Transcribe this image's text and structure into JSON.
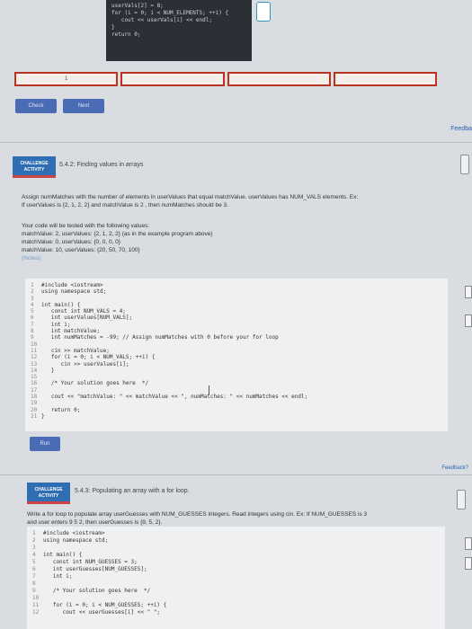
{
  "top_snippet": {
    "lines": [
      "userVals[2] = 8;",
      "",
      "for (i = 0; i < NUM_ELEMENTS; ++i) {",
      "   cout << userVals[i] << endl;",
      "}",
      "",
      "return 0;"
    ]
  },
  "progress": {
    "segments": [
      "1",
      "",
      "",
      ""
    ]
  },
  "buttons": {
    "check": "Check",
    "next": "Next",
    "run": "Run"
  },
  "feedback_top": "Feedba",
  "challenge1": {
    "badge_line1": "CHALLENGE",
    "badge_line2": "ACTIVITY",
    "title": "5.4.2: Finding values in arrays",
    "prose": [
      "Assign numMatches with the number of elements in userValues that equal matchValue. userValues has NUM_VALS elements. Ex:",
      "If userValues is {2, 1, 2, 2} and matchValue is 2 , then numMatches should be 3."
    ],
    "test_intro": "Your code will be tested with the following values:",
    "tests": [
      "matchValue: 2, userValues: {2, 1, 2, 2} (as in the example program above)",
      "matchValue: 0, userValues: {0, 0, 0, 0}",
      "matchValue: 10, userValues: {20, 50, 70, 100}"
    ],
    "notes": "(Notes)"
  },
  "editor1": {
    "lines": [
      {
        "n": "1",
        "t": "#include <iostream>"
      },
      {
        "n": "2",
        "t": "using namespace std;"
      },
      {
        "n": "3",
        "t": ""
      },
      {
        "n": "4",
        "t": "int main() {"
      },
      {
        "n": "5",
        "t": "   const int NUM_VALS = 4;"
      },
      {
        "n": "6",
        "t": "   int userValues[NUM_VALS];"
      },
      {
        "n": "7",
        "t": "   int i;"
      },
      {
        "n": "8",
        "t": "   int matchValue;"
      },
      {
        "n": "9",
        "t": "   int numMatches = -99; // Assign numMatches with 0 before your for loop"
      },
      {
        "n": "10",
        "t": ""
      },
      {
        "n": "11",
        "t": "   cin >> matchValue;"
      },
      {
        "n": "12",
        "t": "   for (i = 0; i < NUM_VALS; ++i) {"
      },
      {
        "n": "13",
        "t": "      cin >> userValues[i];"
      },
      {
        "n": "14",
        "t": "   }"
      },
      {
        "n": "15",
        "t": ""
      },
      {
        "n": "16",
        "t": "   /* Your solution goes here  */"
      },
      {
        "n": "17",
        "t": ""
      },
      {
        "n": "18",
        "t": "   cout << \"matchValue: \" << matchValue << \", numMatches: \" << numMatches << endl;"
      },
      {
        "n": "19",
        "t": ""
      },
      {
        "n": "20",
        "t": "   return 0;"
      },
      {
        "n": "21",
        "t": "}"
      }
    ]
  },
  "feedback_mid": "Feedback?",
  "challenge2": {
    "badge_line1": "CHALLENGE",
    "badge_line2": "ACTIVITY",
    "title": "5.4.3: Populating an array with a for loop.",
    "prose": [
      "Write a for loop to populate array userGuesses with NUM_GUESSES integers. Read integers using cin. Ex: If NUM_GUESSES is 3",
      "and user enters 9 5 2, then userGuesses is {9, 5, 2}."
    ]
  },
  "editor2": {
    "lines": [
      {
        "n": "1",
        "t": "#include <iostream>"
      },
      {
        "n": "2",
        "t": "using namespace std;"
      },
      {
        "n": "3",
        "t": ""
      },
      {
        "n": "4",
        "t": "int main() {"
      },
      {
        "n": "5",
        "t": "   const int NUM_GUESSES = 3;"
      },
      {
        "n": "6",
        "t": "   int userGuesses[NUM_GUESSES];"
      },
      {
        "n": "7",
        "t": "   int i;"
      },
      {
        "n": "8",
        "t": ""
      },
      {
        "n": "9",
        "t": "   /* Your solution goes here  */"
      },
      {
        "n": "10",
        "t": ""
      },
      {
        "n": "11",
        "t": "   for (i = 0; i < NUM_GUESSES; ++i) {"
      },
      {
        "n": "12",
        "t": "      cout << userGuesses[i] << \" \";"
      }
    ]
  }
}
